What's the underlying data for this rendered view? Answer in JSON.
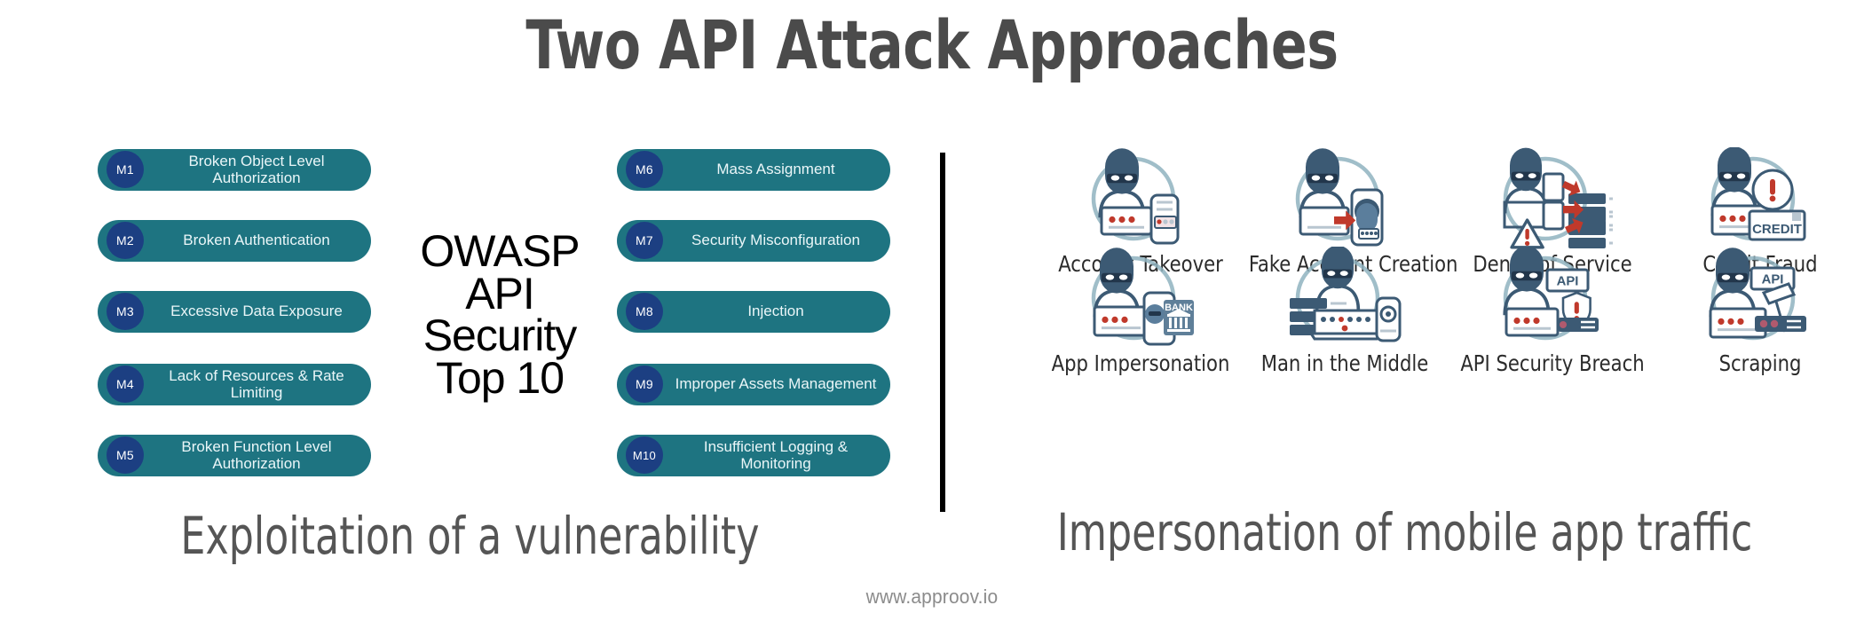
{
  "header": {
    "title": "Two API Attack Approaches"
  },
  "center_block": {
    "lines": [
      "OWASP",
      "API",
      "Security",
      "Top 10"
    ]
  },
  "owasp_top10": {
    "column_left": [
      {
        "code": "M1",
        "label": "Broken Object Level Authorization"
      },
      {
        "code": "M2",
        "label": "Broken Authentication"
      },
      {
        "code": "M3",
        "label": "Excessive Data Exposure"
      },
      {
        "code": "M4",
        "label": "Lack of Resources & Rate Limiting"
      },
      {
        "code": "M5",
        "label": "Broken Function Level Authorization"
      }
    ],
    "column_right": [
      {
        "code": "M6",
        "label": "Mass Assignment"
      },
      {
        "code": "M7",
        "label": "Security Misconfiguration"
      },
      {
        "code": "M8",
        "label": "Injection"
      },
      {
        "code": "M9",
        "label": "Improper Assets Management"
      },
      {
        "code": "M10",
        "label": "Insufficient Logging & Monitoring"
      }
    ]
  },
  "attack_icons": [
    {
      "label": "Account Takeover",
      "icon": "masked-attacker-phone-password-icon"
    },
    {
      "label": "Fake Account Creation",
      "icon": "masked-attacker-fake-face-icon"
    },
    {
      "label": "Denial of Service",
      "icon": "masked-attacker-flood-servers-warning-icon"
    },
    {
      "label": "Credit Fraud",
      "icon": "masked-attacker-credit-card-alert-icon"
    },
    {
      "label": "App Impersonation",
      "icon": "masked-attacker-fake-bank-app-icon"
    },
    {
      "label": "Man in the Middle",
      "icon": "masked-attacker-intercept-servers-icon"
    },
    {
      "label": "API Security Breach",
      "icon": "masked-attacker-api-shield-alert-icon"
    },
    {
      "label": "Scraping",
      "icon": "masked-attacker-api-scraper-icon"
    }
  ],
  "captions": {
    "left": "Exploitation of a vulnerability",
    "right": "Impersonation of mobile app traffic"
  },
  "footer": {
    "url": "www.approov.io"
  },
  "colors": {
    "pill": "#1e7481",
    "badge": "#1c3f82",
    "title": "#4b4b4b",
    "caption": "#555555",
    "divider": "#000000",
    "icon_outline": "#8fb3bf",
    "icon_dark": "#3c5a74",
    "icon_accent_red": "#c0392b"
  }
}
